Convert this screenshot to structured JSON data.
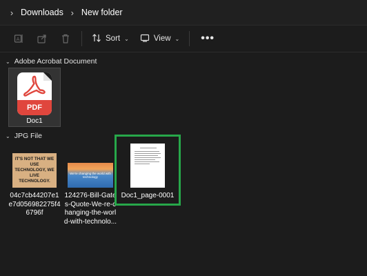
{
  "breadcrumb": {
    "items": [
      "Downloads",
      "New folder"
    ]
  },
  "toolbar": {
    "sort_label": "Sort",
    "view_label": "View",
    "more_label": "•••",
    "icons": [
      "rename-icon",
      "share-icon",
      "delete-icon",
      "sort-icon",
      "view-icon"
    ]
  },
  "groups": [
    {
      "header": "Adobe Acrobat Document",
      "items": [
        {
          "label": "Doc1",
          "icon_text": "PDF",
          "selected": true
        }
      ]
    },
    {
      "header": "JPG File",
      "items": [
        {
          "label": "04c7cb44207e1e7d056982275f46796f",
          "thumb_text": "IT'S NOT THAT WE USE TECHNOLOGY, WE LIVE TECHNOLOGY."
        },
        {
          "label": "124276-Bill-Gates-Quote-We-re-changing-the-world-with-technolo...",
          "thumb_text": "We're changing the world with technology"
        },
        {
          "label": "Doc1_page-0001",
          "highlighted": true
        }
      ]
    }
  ],
  "colors": {
    "background": "#1c1c1c",
    "highlight": "#27a84a",
    "pdf_red": "#e0463d"
  }
}
